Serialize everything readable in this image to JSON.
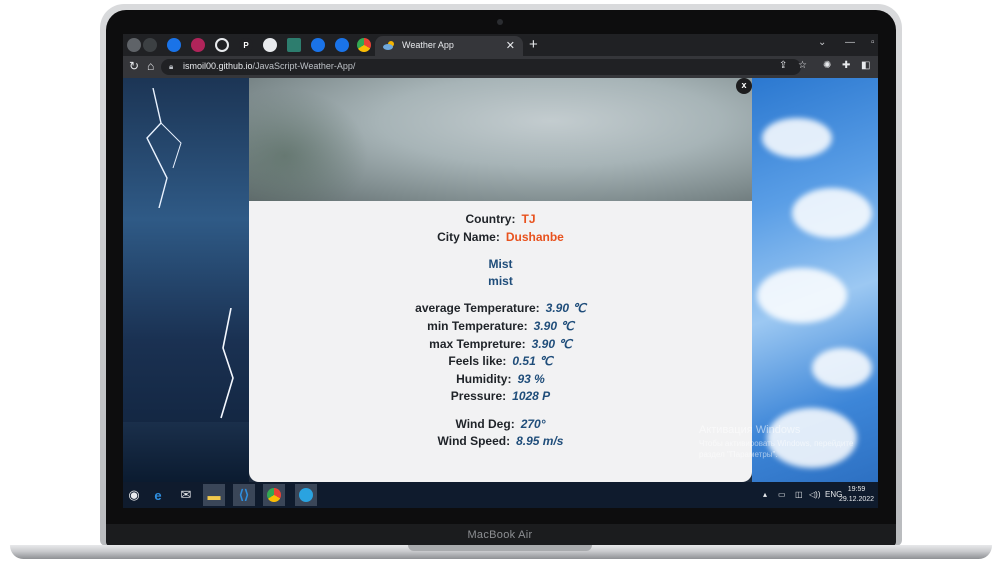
{
  "device": {
    "brand": "MacBook Air"
  },
  "browser": {
    "active_tab_title": "Weather App",
    "url_host": "ismoil00.github.io",
    "url_path": "/JavaScript-Weather-App/"
  },
  "weather": {
    "country_label": "Country:",
    "country": "TJ",
    "city_label": "City Name:",
    "city": "Dushanbe",
    "main": "Mist",
    "description": "mist",
    "avg_temp_label": "average Temperature:",
    "avg_temp": "3.90 ℃",
    "min_temp_label": "min Temperature:",
    "min_temp": "3.90 ℃",
    "max_temp_label": "max Tempreture:",
    "max_temp": "3.90 ℃",
    "feels_like_label": "Feels like:",
    "feels_like": "0.51 ℃",
    "humidity_label": "Humidity:",
    "humidity": "93 %",
    "pressure_label": "Pressure:",
    "pressure": "1028 P",
    "wind_deg_label": "Wind Deg:",
    "wind_deg": "270°",
    "wind_speed_label": "Wind Speed:",
    "wind_speed": "8.95 m/s",
    "close_label": "x"
  },
  "windows_watermark": {
    "title": "Активация Windows",
    "line1": "Чтобы активировать Windows, перейдите",
    "line2": "раздел \"Параметры\"."
  },
  "taskbar": {
    "language": "ENG",
    "time": "19:59",
    "date": "29.12.2022"
  }
}
